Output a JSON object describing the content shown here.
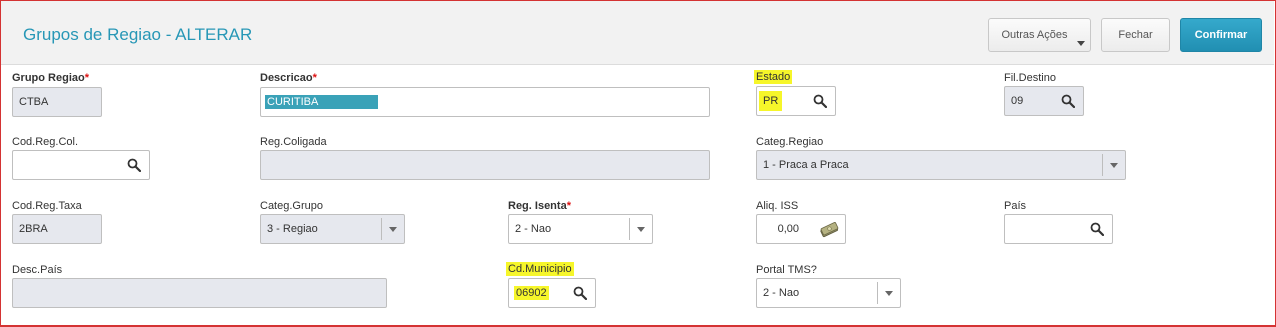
{
  "header": {
    "title": "Grupos de Regiao - ALTERAR",
    "buttons": {
      "outras": "Outras Ações",
      "fechar": "Fechar",
      "confirmar": "Confirmar"
    }
  },
  "colors": {
    "accent": "#2797b6",
    "confirm": "#218fb2",
    "highlight": "#f6f62a",
    "required": "#dd1111",
    "readonly_bg": "#e6e8ee"
  },
  "fields": {
    "grupo_regiao": {
      "label": "Grupo Regiao",
      "value": "CTBA"
    },
    "descricao": {
      "label": "Descricao",
      "value": "CURITIBA"
    },
    "estado": {
      "label": "Estado",
      "value": "PR"
    },
    "fil_destino": {
      "label": "Fil.Destino",
      "value": "09"
    },
    "cod_reg_col": {
      "label": "Cod.Reg.Col.",
      "value": ""
    },
    "reg_coligada": {
      "label": "Reg.Coligada",
      "value": ""
    },
    "categ_regiao": {
      "label": "Categ.Regiao",
      "value": "1 - Praca a Praca"
    },
    "cod_reg_taxa": {
      "label": "Cod.Reg.Taxa",
      "value": "2BRA"
    },
    "categ_grupo": {
      "label": "Categ.Grupo",
      "value": "3 - Regiao"
    },
    "reg_isenta": {
      "label": "Reg. Isenta",
      "value": "2 - Nao"
    },
    "aliq_iss": {
      "label": "Aliq. ISS",
      "value": "0,00"
    },
    "pais": {
      "label": "País",
      "value": ""
    },
    "desc_pais": {
      "label": "Desc.País",
      "value": ""
    },
    "cd_municipio": {
      "label": "Cd.Municipio",
      "value": "06902"
    },
    "portal_tms": {
      "label": "Portal TMS?",
      "value": "2 - Nao"
    }
  },
  "required_mark": "*"
}
